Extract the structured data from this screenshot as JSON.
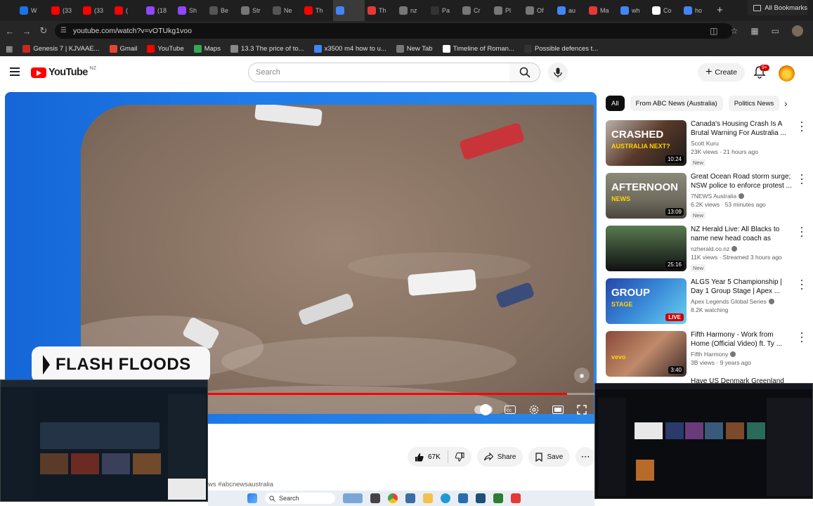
{
  "browser": {
    "tabs": [
      {
        "label": "W",
        "color": "#1a73e8"
      },
      {
        "label": "(33",
        "color": "#ff0000"
      },
      {
        "label": "(33",
        "color": "#ff0000"
      },
      {
        "label": "(",
        "color": "#ff0000"
      },
      {
        "label": "(18",
        "color": "#9146ff"
      },
      {
        "label": "Sh",
        "color": "#9146ff"
      },
      {
        "label": "Be",
        "color": "#555555"
      },
      {
        "label": "Str",
        "color": "#777777"
      },
      {
        "label": "Ne",
        "color": "#555555"
      },
      {
        "label": "Th",
        "color": "#ff0000"
      },
      {
        "label": "",
        "color": "#4285f4"
      },
      {
        "label": "Th",
        "color": "#e53935"
      },
      {
        "label": "nz",
        "color": "#777777"
      },
      {
        "label": "Pa",
        "color": "#333333"
      },
      {
        "label": "Cr",
        "color": "#777777"
      },
      {
        "label": "Pl",
        "color": "#777777"
      },
      {
        "label": "Of",
        "color": "#777777"
      },
      {
        "label": "au",
        "color": "#4285f4"
      },
      {
        "label": "Ma",
        "color": "#e53935"
      },
      {
        "label": "wh",
        "color": "#4285f4"
      },
      {
        "label": "Co",
        "color": "#ffffff"
      },
      {
        "label": "ho",
        "color": "#4285f4"
      }
    ],
    "url": "youtube.com/watch?v=vOTUkg1voo",
    "bookmarks": [
      {
        "label": "Genesis 7 | KJVAAE...",
        "color": "#c62828"
      },
      {
        "label": "Gmail",
        "color": "#ea4335"
      },
      {
        "label": "YouTube",
        "color": "#ff0000"
      },
      {
        "label": "Maps",
        "color": "#34a853"
      },
      {
        "label": "13.3 The price of to...",
        "color": "#888888"
      },
      {
        "label": "x3500 m4 how to u...",
        "color": "#4285f4"
      },
      {
        "label": "New Tab",
        "color": "#777777"
      },
      {
        "label": "Timeline of Roman...",
        "color": "#ffffff"
      },
      {
        "label": "Possible defences t...",
        "color": "#333333"
      }
    ],
    "all_bookmarks": "All Bookmarks"
  },
  "youtube": {
    "country": "NZ",
    "logo_text": "YouTube",
    "search_placeholder": "Search",
    "create_label": "Create",
    "notif_count": "9+"
  },
  "video": {
    "lower_third": "FLASH FLOODS",
    "progress": 0.95,
    "hashtag": "ws #abcnewsaustralia",
    "likes": "67K",
    "share_label": "Share",
    "save_label": "Save"
  },
  "chips": [
    {
      "label": "All",
      "active": true
    },
    {
      "label": "From ABC News (Australia)",
      "active": false
    },
    {
      "label": "Politics News",
      "active": false
    }
  ],
  "related": [
    {
      "title": "Canada's Housing Crash Is A Brutal Warning For Australia ...",
      "channel": "Scott Kuru",
      "verified": false,
      "meta": "23K views · 21 hours ago",
      "badge": "New",
      "duration": "10:24",
      "thumb_top": "CRASHED",
      "thumb_sub": "AUSTRALIA NEXT?"
    },
    {
      "title": "Great Ocean Road storm surge; NSW police to enforce protest ...",
      "channel": "7NEWS Australia",
      "verified": true,
      "meta": "6.2K views · 53 minutes ago",
      "badge": "New",
      "duration": "13:09",
      "thumb_top": "AFTERNOON",
      "thumb_sub": "NEWS"
    },
    {
      "title": "NZ Herald Live: All Blacks to name new head coach as Scott...",
      "channel": "nzherald.co.nz",
      "verified": true,
      "meta": "11K views · Streamed 3 hours ago",
      "badge": "New",
      "duration": "25:16",
      "thumb_top": "",
      "thumb_sub": ""
    },
    {
      "title": "ALGS Year 5 Championship | Day 1 Group Stage | Apex ...",
      "channel": "Apex Legends Global Series",
      "verified": true,
      "meta": "8.2K watching",
      "badge": "",
      "duration": "LIVE",
      "thumb_top": "GROUP",
      "thumb_sub": "STAGE"
    },
    {
      "title": "Fifth Harmony - Work from Home (Official Video) ft. Ty ...",
      "channel": "Fifth Harmony",
      "verified": true,
      "meta": "3B views · 9 years ago",
      "badge": "",
      "duration": "3:40",
      "thumb_top": "",
      "thumb_sub": "vevo"
    }
  ],
  "partial_next": "Have US Denmark Greenland",
  "taskbar": {
    "search": "Search"
  }
}
